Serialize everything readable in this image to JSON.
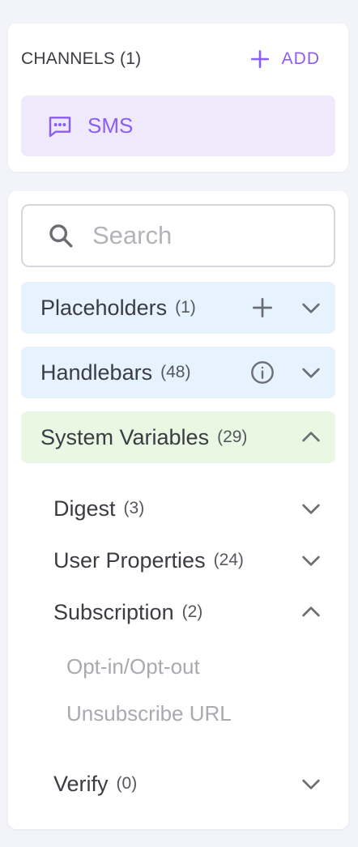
{
  "channels": {
    "title": "CHANNELS (1)",
    "add_label": "ADD",
    "items": [
      {
        "label": "SMS",
        "icon": "message-icon"
      }
    ]
  },
  "search": {
    "placeholder": "Search",
    "value": ""
  },
  "sections": [
    {
      "label": "Placeholders",
      "count": "(1)",
      "expanded": false,
      "action_icon": "plus-icon"
    },
    {
      "label": "Handlebars",
      "count": "(48)",
      "expanded": false,
      "action_icon": "info-icon"
    },
    {
      "label": "System Variables",
      "count": "(29)",
      "expanded": true,
      "children": [
        {
          "label": "Digest",
          "count": "(3)",
          "expanded": false
        },
        {
          "label": "User Properties",
          "count": "(24)",
          "expanded": false
        },
        {
          "label": "Subscription",
          "count": "(2)",
          "expanded": true,
          "items": [
            "Opt-in/Opt-out",
            "Unsubscribe URL"
          ]
        },
        {
          "label": "Verify",
          "count": "(0)",
          "expanded": false
        }
      ]
    }
  ],
  "colors": {
    "accent": "#8b5cf6",
    "accent_bg": "#efe9fc",
    "section_blue": "#e6f2fe",
    "section_green": "#e9f7e3",
    "page_bg": "#f3f4f9"
  }
}
